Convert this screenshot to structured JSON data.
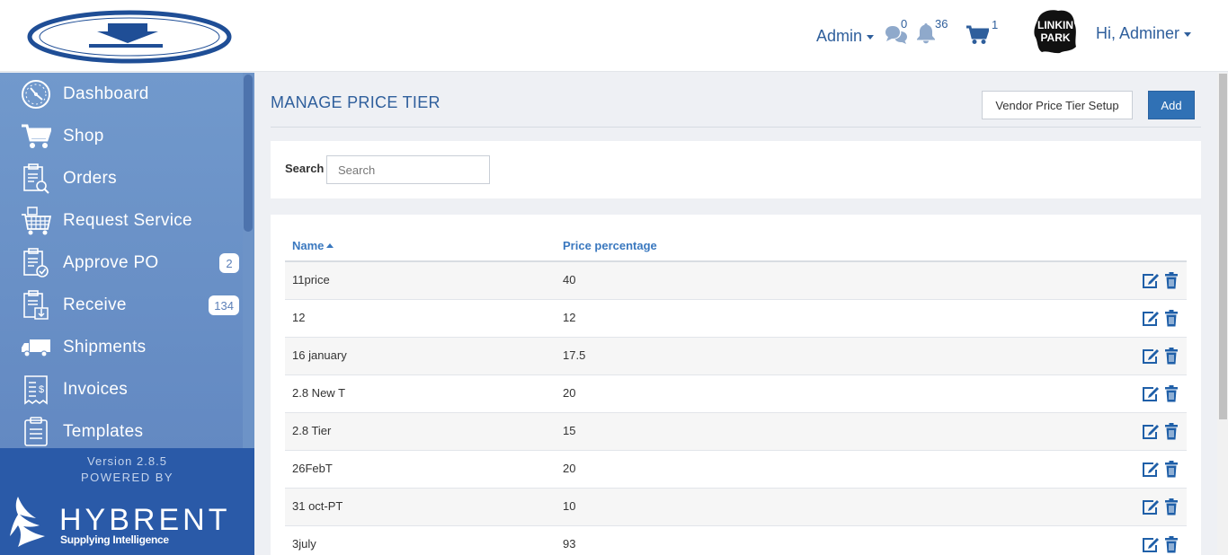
{
  "header": {
    "admin_label": "Admin",
    "messages_count": "0",
    "notifications_count": "36",
    "cart_count": "1",
    "user_greeting": "Hi, Adminer",
    "avatar_text": "LINKIN PARK"
  },
  "sidebar": {
    "items": [
      {
        "label": "Dashboard",
        "icon": "dashboard-gauge-icon"
      },
      {
        "label": "Shop",
        "icon": "cart-icon"
      },
      {
        "label": "Orders",
        "icon": "clipboard-search-icon"
      },
      {
        "label": "Request Service",
        "icon": "building-cart-icon"
      },
      {
        "label": "Approve PO",
        "icon": "clipboard-check-icon",
        "badge": "2"
      },
      {
        "label": "Receive",
        "icon": "clipboard-download-icon",
        "badge": "134"
      },
      {
        "label": "Shipments",
        "icon": "truck-icon"
      },
      {
        "label": "Invoices",
        "icon": "invoice-icon"
      },
      {
        "label": "Templates",
        "icon": "clipboard-icon"
      }
    ],
    "version": "Version 2.8.5",
    "powered_by": "POWERED BY",
    "brand": "HYBRENT",
    "tagline": "Supplying Intelligence"
  },
  "main": {
    "title": "MANAGE PRICE TIER",
    "vendor_button": "Vendor Price Tier Setup",
    "add_button": "Add",
    "search_label": "Search",
    "search_placeholder": "Search",
    "columns": {
      "name": "Name",
      "price": "Price percentage"
    },
    "rows": [
      {
        "name": "11price",
        "price": "40"
      },
      {
        "name": "12",
        "price": "12"
      },
      {
        "name": "16 january",
        "price": "17.5"
      },
      {
        "name": "2.8 New T",
        "price": "20"
      },
      {
        "name": "2.8 Tier",
        "price": "15"
      },
      {
        "name": "26FebT",
        "price": "20"
      },
      {
        "name": "31 oct-PT",
        "price": "10"
      },
      {
        "name": "3july",
        "price": "93"
      }
    ]
  },
  "colors": {
    "primary": "#2f5f9c",
    "sidebar": "#6d93c7",
    "sidebar_footer": "#2a5aa8",
    "button": "#3071b5"
  }
}
